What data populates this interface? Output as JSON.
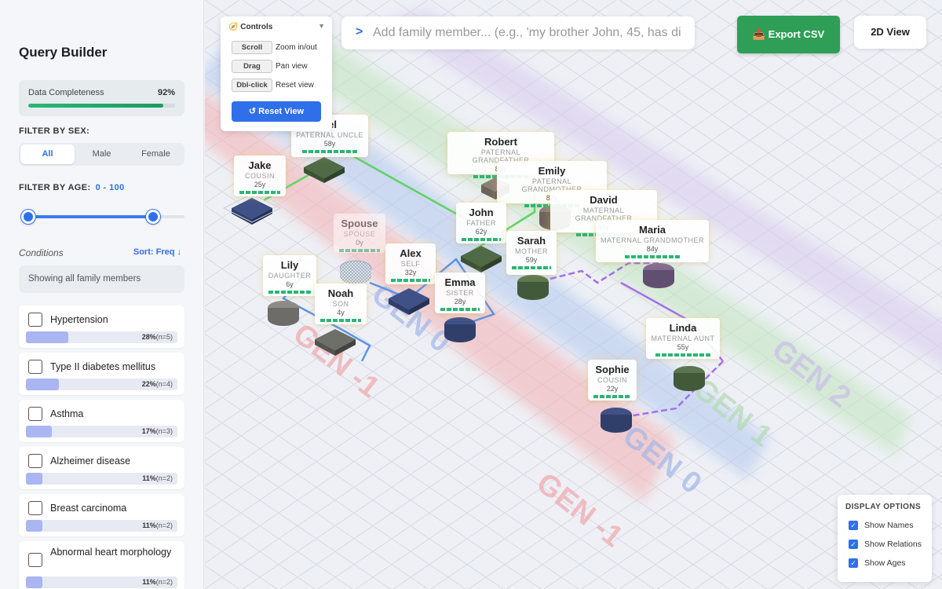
{
  "sidebar": {
    "title": "Query Builder",
    "completeness": {
      "label": "Data Completeness",
      "value": "92%",
      "fraction": 0.92
    },
    "filter_sex": {
      "label": "FILTER BY SEX:",
      "options": [
        "All",
        "Male",
        "Female"
      ],
      "selected": "All"
    },
    "filter_age": {
      "label": "FILTER BY AGE:",
      "range": "0 - 100",
      "min": 0,
      "max": 100
    },
    "conditions": {
      "label": "Conditions",
      "sort": "Sort: Freq ↓",
      "showing": "Showing all family members",
      "items": [
        {
          "name": "Hypertension",
          "pct": "28%",
          "n": "(n=5)",
          "fraction": 0.28
        },
        {
          "name": "Type II diabetes mellitus",
          "pct": "22%",
          "n": "(n=4)",
          "fraction": 0.22
        },
        {
          "name": "Asthma",
          "pct": "17%",
          "n": "(n=3)",
          "fraction": 0.17
        },
        {
          "name": "Alzheimer disease",
          "pct": "11%",
          "n": "(n=2)",
          "fraction": 0.11
        },
        {
          "name": "Breast carcinoma",
          "pct": "11%",
          "n": "(n=2)",
          "fraction": 0.11
        },
        {
          "name": "Abnormal heart morphology",
          "pct": "11%",
          "n": "(n=2)",
          "fraction": 0.11
        }
      ]
    }
  },
  "controls": {
    "title": "Controls",
    "icon": "compass-icon",
    "rows": [
      {
        "key": "Scroll",
        "action": "Zoom in/out"
      },
      {
        "key": "Drag",
        "action": "Pan view"
      },
      {
        "key": "Dbl-click",
        "action": "Reset view"
      }
    ],
    "reset_label": "↺ Reset View"
  },
  "command": {
    "prompt": ">",
    "placeholder": "Add family member... (e.g., 'my brother John, 45, has di"
  },
  "toolbar": {
    "export_label": "📥 Export CSV",
    "view_label": "2D View"
  },
  "generations": [
    "GEN -1",
    "GEN 0",
    "GEN 1",
    "GEN 2"
  ],
  "members": [
    {
      "name": "Michael",
      "display_name": "ael",
      "relation": "PATERNAL UNCLE",
      "age": "58y"
    },
    {
      "name": "Jake",
      "relation": "COUSIN",
      "age": "25y"
    },
    {
      "name": "Robert",
      "relation": "PATERNAL GRANDFATHER",
      "age": "85y"
    },
    {
      "name": "Emily",
      "relation": "PATERNAL GRANDMOTHER",
      "age": "82y"
    },
    {
      "name": "David",
      "relation": "MATERNAL GRANDFATHER",
      "age": "86y"
    },
    {
      "name": "John",
      "relation": "FATHER",
      "age": "62y"
    },
    {
      "name": "Maria",
      "relation": "MATERNAL GRANDMOTHER",
      "age": "84y"
    },
    {
      "name": "Sarah",
      "relation": "MOTHER",
      "age": "59y"
    },
    {
      "name": "Spouse",
      "relation": "SPOUSE",
      "age": "0y",
      "placeholder": true
    },
    {
      "name": "Alex",
      "relation": "SELF",
      "age": "32y"
    },
    {
      "name": "Lily",
      "relation": "DAUGHTER",
      "age": "6y"
    },
    {
      "name": "Emma",
      "relation": "SISTER",
      "age": "28y"
    },
    {
      "name": "Noah",
      "relation": "SON",
      "age": "4y"
    },
    {
      "name": "Linda",
      "relation": "MATERNAL AUNT",
      "age": "55y"
    },
    {
      "name": "Sophie",
      "relation": "COUSIN",
      "age": "22y"
    }
  ],
  "display_options": {
    "title": "DISPLAY OPTIONS",
    "items": [
      {
        "label": "Show Names",
        "checked": true
      },
      {
        "label": "Show Relations",
        "checked": true
      },
      {
        "label": "Show Ages",
        "checked": true
      }
    ]
  }
}
